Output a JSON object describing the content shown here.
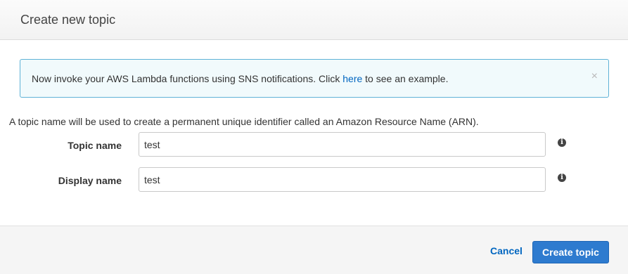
{
  "dialog": {
    "title": "Create new topic"
  },
  "alert": {
    "text_before": "Now invoke your AWS Lambda functions using SNS notifications. Click ",
    "link_text": "here",
    "text_after": " to see an example.",
    "close_glyph": "×"
  },
  "description": "A topic name will be used to create a permanent unique identifier called an Amazon Resource Name (ARN).",
  "form": {
    "topic_name": {
      "label": "Topic name",
      "value": "test",
      "info_icon": "info-circle-icon"
    },
    "display_name": {
      "label": "Display name",
      "value": "test",
      "info_icon": "info-circle-icon"
    }
  },
  "footer": {
    "cancel_label": "Cancel",
    "create_label": "Create topic"
  },
  "colors": {
    "primary_button": "#2e7bcf",
    "link": "#0066c0",
    "alert_border": "#5fb2d6",
    "alert_background": "#f1fafc"
  }
}
